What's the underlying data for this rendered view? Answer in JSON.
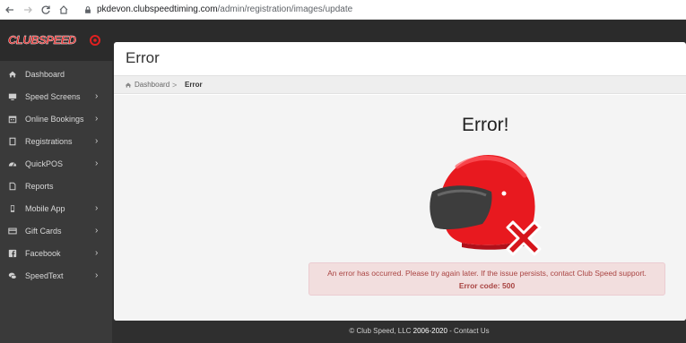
{
  "browser": {
    "url_domain": "pkdevon.clubspeedtiming.com",
    "url_path": "/admin/registration/images/update"
  },
  "logo": {
    "text": "CLUBSPEED"
  },
  "sidebar": {
    "items": [
      {
        "label": "Dashboard",
        "icon": "home-icon",
        "has_submenu": false
      },
      {
        "label": "Speed Screens",
        "icon": "monitor-icon",
        "has_submenu": true
      },
      {
        "label": "Online Bookings",
        "icon": "calendar-icon",
        "has_submenu": true
      },
      {
        "label": "Registrations",
        "icon": "tablet-icon",
        "has_submenu": true
      },
      {
        "label": "QuickPOS",
        "icon": "tachometer-icon",
        "has_submenu": true
      },
      {
        "label": "Reports",
        "icon": "file-icon",
        "has_submenu": false
      },
      {
        "label": "Mobile App",
        "icon": "mobile-icon",
        "has_submenu": true
      },
      {
        "label": "Gift Cards",
        "icon": "credit-card-icon",
        "has_submenu": true
      },
      {
        "label": "Facebook",
        "icon": "facebook-icon",
        "has_submenu": true
      },
      {
        "label": "SpeedText",
        "icon": "comments-icon",
        "has_submenu": true
      }
    ],
    "chevron": "›"
  },
  "page": {
    "title": "Error",
    "breadcrumb": {
      "home": "Dashboard",
      "separator": ">",
      "current": "Error"
    },
    "error_heading": "Error!",
    "alert_message": "An error has occurred. Please try again later. If the issue persists, contact Club Speed support.",
    "alert_code": "Error code: 500"
  },
  "footer": {
    "prefix": "© Club Speed, LLC",
    "years": "2006-2020",
    "link": "- Contact Us"
  },
  "colors": {
    "accent_red": "#e02020",
    "alert_bg": "#f2dede",
    "alert_text": "#a94442",
    "sidebar_bg": "#3a3a3a"
  }
}
